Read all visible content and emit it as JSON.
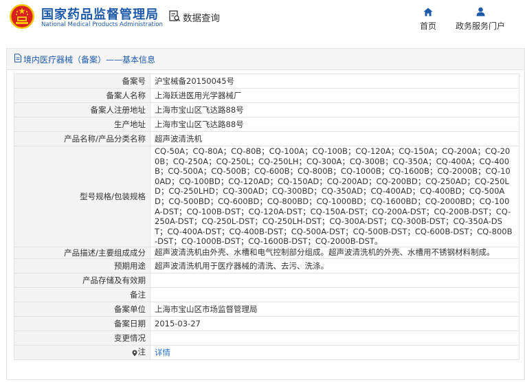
{
  "header": {
    "brand_cn": "国家药品监督管理局",
    "brand_en": "National Medical Products Administration",
    "query_label": "数据查询",
    "nav": [
      {
        "label": "首页",
        "icon": "home-icon"
      },
      {
        "label": "政务服务门户",
        "icon": "user-icon"
      }
    ],
    "colors": {
      "brand": "#1e5aa8",
      "emblem_red": "#d7201f",
      "emblem_gold": "#f5c400"
    }
  },
  "panel": {
    "title": "境内医疗器械（备案）——基本信息",
    "rows": [
      {
        "label": "备案号",
        "value": "沪宝械备20150045号"
      },
      {
        "label": "备案人名称",
        "value": "上海跃进医用光学器械厂"
      },
      {
        "label": "备案人注册地址",
        "value": "上海市宝山区飞达路88号"
      },
      {
        "label": "生产地址",
        "value": "上海市宝山区飞达路88号"
      },
      {
        "label": "产品名称/产品分类名称",
        "value": "超声波清洗机"
      },
      {
        "label": "型号规格/包装规格",
        "value": "CQ-50A；CQ-80A；CQ-80B；CQ-100A；CQ-100B；CQ-120A；CQ-150A；CQ-200A；CQ-200B；CQ-250A；CQ-250L；CQ-250LH；CQ-300A；CQ-300B；CQ-350A；CQ-400A；CQ-400B；CQ-500A；CQ-500B；CQ-600B；CQ-800B；CQ-1000B；CQ-1600B；CQ-2000B；CQ-100AD；CQ-100BD；CQ-120AD；CQ-150AD；CQ-200AD；CQ-200BD；CQ-250AD；CQ-250LD；CQ-250LHD；CQ-300AD；CQ-300BD；CQ-350AD；CQ-400AD；CQ-400BD；CQ-500AD；CQ-500BD；CQ-600BD；CQ-800BD；CQ-1000BD；CQ-1600BD；CQ-2000BD；CQ-100A-DST；CQ-100B-DST；CQ-120A-DST；CQ-150A-DST；CQ-200A-DST；CQ-200B-DST；CQ-250A-DST；CQ-250L-DST；CQ-250LH-DST；CQ-300A-DST；CQ-300B-DST；CQ-350A-DST；CQ-400A-DST；CQ-400B-DST；CQ-500A-DST；CQ-500B-DST；CQ-600B-DST；CQ-800B-DST；CQ-1000B-DST；CQ-1600B-DST；CQ-2000B-DST。"
      },
      {
        "label": "产品描述/主要组成成分",
        "value": "超声波清洗机由外壳、水槽和电气控制部分组成。超声波清洗机的外壳、水槽用不锈钢材料制成。"
      },
      {
        "label": "预期用途",
        "value": "超声波清洗机用于医疗器械的清洗、去污、洗涤。"
      },
      {
        "label": "产品存储及有效期",
        "value": ""
      },
      {
        "label": "备注",
        "value": ""
      },
      {
        "label": "备案单位",
        "value": "上海市宝山区市场监督管理局"
      },
      {
        "label": "备案日期",
        "value": "2015-03-27"
      },
      {
        "label": "变更情况",
        "value": ""
      },
      {
        "label": "注",
        "value": "详情"
      }
    ]
  }
}
